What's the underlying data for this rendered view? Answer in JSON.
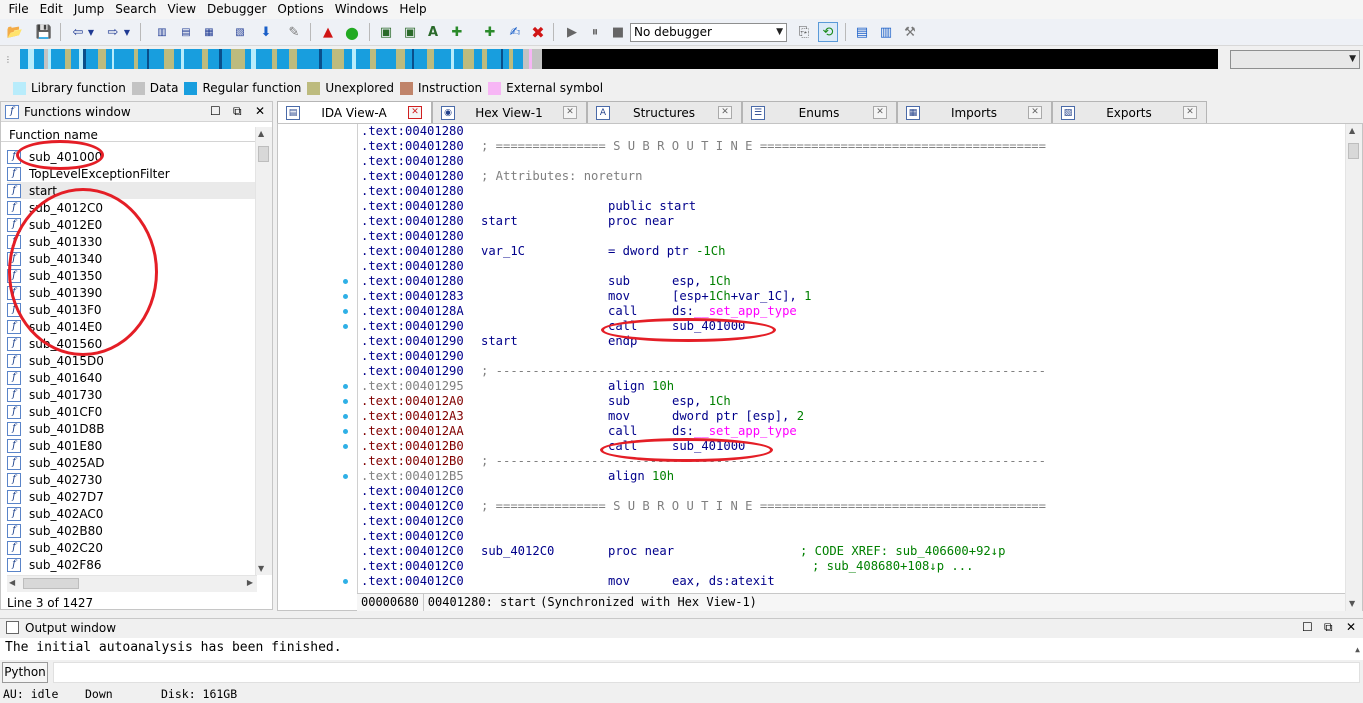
{
  "menu": [
    "File",
    "Edit",
    "Jump",
    "Search",
    "View",
    "Debugger",
    "Options",
    "Windows",
    "Help"
  ],
  "toolbar": {
    "debugger_select": "No debugger"
  },
  "legend": [
    {
      "label": "Library function",
      "color": "#b8ecfb"
    },
    {
      "label": "Data",
      "color": "#c3c3c3"
    },
    {
      "label": "Regular function",
      "color": "#189ede"
    },
    {
      "label": "Unexplored",
      "color": "#bdbb7e"
    },
    {
      "label": "Instruction",
      "color": "#c0846a"
    },
    {
      "label": "External symbol",
      "color": "#f7b6f5"
    }
  ],
  "functions_window": {
    "title": "Functions window",
    "column_header": "Function name",
    "items": [
      "sub_401000",
      "TopLevelExceptionFilter",
      "start",
      "sub_4012C0",
      "sub_4012E0",
      "sub_401330",
      "sub_401340",
      "sub_401350",
      "sub_401390",
      "sub_4013F0",
      "sub_4014E0",
      "sub_401560",
      "sub_4015D0",
      "sub_401640",
      "sub_401730",
      "sub_401CF0",
      "sub_401D8B",
      "sub_401E80",
      "sub_4025AD",
      "sub_402730",
      "sub_4027D7",
      "sub_402AC0",
      "sub_402B80",
      "sub_402C20",
      "sub_402F86"
    ],
    "selected_index": 2,
    "status": "Line 3 of 1427"
  },
  "tabs": [
    {
      "label": "IDA View-A",
      "icon": "ida-view-icon",
      "active": true
    },
    {
      "label": "Hex View-1",
      "icon": "hex-view-icon",
      "active": false
    },
    {
      "label": "Structures",
      "icon": "structures-icon",
      "active": false
    },
    {
      "label": "Enums",
      "icon": "enums-icon",
      "active": false
    },
    {
      "label": "Imports",
      "icon": "imports-icon",
      "active": false
    },
    {
      "label": "Exports",
      "icon": "exports-icon",
      "active": false
    }
  ],
  "code_lines": [
    {
      "seg": ".text:00401280",
      "c": "n"
    },
    {
      "seg": ".text:00401280",
      "c": "n",
      "text": "; =============== S U B R O U T I N E ======================================="
    },
    {
      "seg": ".text:00401280",
      "c": "n"
    },
    {
      "seg": ".text:00401280",
      "c": "n",
      "text": "; Attributes: noreturn"
    },
    {
      "seg": ".text:00401280",
      "c": "n"
    },
    {
      "seg": ".text:00401280",
      "c": "n",
      "mn": "public start"
    },
    {
      "seg": ".text:00401280",
      "c": "n",
      "lbl": "start",
      "mn": "proc near"
    },
    {
      "seg": ".text:00401280",
      "c": "n"
    },
    {
      "seg": ".text:00401280",
      "c": "n",
      "lbl": "var_1C",
      "mn": "= dword ptr -1Ch"
    },
    {
      "seg": ".text:00401280",
      "c": "n"
    },
    {
      "seg": ".text:00401280",
      "c": "n",
      "dot": true,
      "mn": "sub",
      "op": "esp, 1Ch"
    },
    {
      "seg": ".text:00401283",
      "c": "n",
      "dot": true,
      "mn": "mov",
      "op": "[esp+1Ch+var_1C], 1"
    },
    {
      "seg": ".text:0040128A",
      "c": "n",
      "dot": true,
      "mn": "call",
      "op": "ds:__set_app_type"
    },
    {
      "seg": ".text:00401290",
      "c": "n",
      "dot": true,
      "mn": "call",
      "op": "sub_401000"
    },
    {
      "seg": ".text:00401290",
      "c": "n",
      "lbl": "start",
      "mn": "endp"
    },
    {
      "seg": ".text:00401290",
      "c": "n"
    },
    {
      "seg": ".text:00401290",
      "c": "n",
      "text": "; ---------------------------------------------------------------------------"
    },
    {
      "seg": ".text:00401295",
      "c": "g",
      "dot": true,
      "mn": "align 10h"
    },
    {
      "seg": ".text:004012A0",
      "c": "r",
      "dot": true,
      "mn": "sub",
      "op": "esp, 1Ch"
    },
    {
      "seg": ".text:004012A3",
      "c": "r",
      "dot": true,
      "mn": "mov",
      "op": "dword ptr [esp], 2"
    },
    {
      "seg": ".text:004012AA",
      "c": "r",
      "dot": true,
      "mn": "call",
      "op": "ds:__set_app_type"
    },
    {
      "seg": ".text:004012B0",
      "c": "r",
      "dot": true,
      "mn": "call",
      "op": "sub_401000"
    },
    {
      "seg": ".text:004012B0",
      "c": "r",
      "text": "; ---------------------------------------------------------------------------"
    },
    {
      "seg": ".text:004012B5",
      "c": "g",
      "dot": true,
      "mn": "align 10h"
    },
    {
      "seg": ".text:004012C0",
      "c": "n"
    },
    {
      "seg": ".text:004012C0",
      "c": "n",
      "text": "; =============== S U B R O U T I N E ======================================="
    },
    {
      "seg": ".text:004012C0",
      "c": "n"
    },
    {
      "seg": ".text:004012C0",
      "c": "n"
    },
    {
      "seg": ".text:004012C0",
      "c": "n",
      "lbl": "sub_4012C0",
      "mn": "proc near",
      "cm": "; CODE XREF: sub_406600+92↓p"
    },
    {
      "seg": ".text:004012C0",
      "c": "n",
      "cm": "; sub_408680+108↓p ..."
    },
    {
      "seg": ".text:004012C0",
      "c": "n",
      "dot": true,
      "mn": "mov",
      "op": "eax, ds:atexit"
    }
  ],
  "code_status": {
    "offset": "00000680",
    "location": "00401280: start",
    "sync": "(Synchronized with Hex View-1)"
  },
  "output_window": {
    "title": "Output window",
    "text": "The initial autoanalysis has been finished."
  },
  "python_button": "Python",
  "statusbar": {
    "au": "AU:  idle",
    "direction": "Down",
    "disk": "Disk: 161GB"
  }
}
